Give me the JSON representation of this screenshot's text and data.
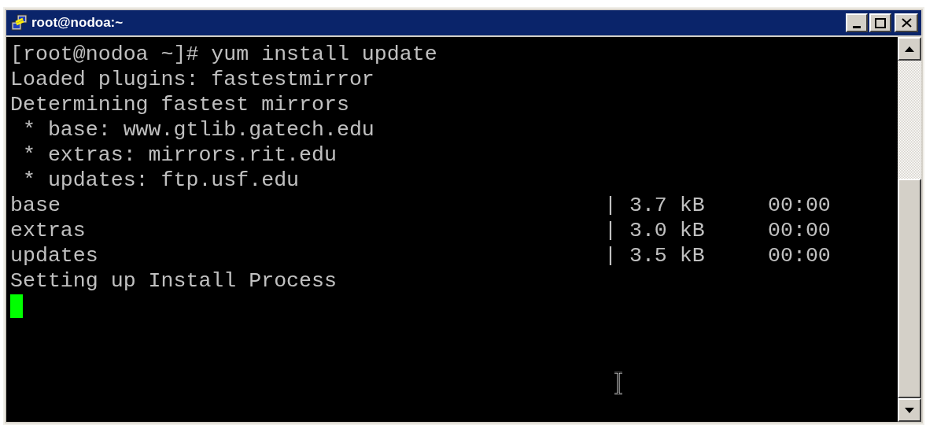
{
  "window": {
    "title": "root@nodoa:~"
  },
  "terminal": {
    "lines": [
      {
        "kind": "text",
        "text": "[root@nodoa ~]# yum install update"
      },
      {
        "kind": "text",
        "text": "Loaded plugins: fastestmirror"
      },
      {
        "kind": "text",
        "text": "Determining fastest mirrors"
      },
      {
        "kind": "text",
        "text": " * base: www.gtlib.gatech.edu"
      },
      {
        "kind": "text",
        "text": " * extras: mirrors.rit.edu"
      },
      {
        "kind": "text",
        "text": " * updates: ftp.usf.edu"
      },
      {
        "kind": "row",
        "name": "base",
        "size": "| 3.7 kB",
        "time": "00:00"
      },
      {
        "kind": "row",
        "name": "extras",
        "size": "| 3.0 kB",
        "time": "00:00"
      },
      {
        "kind": "row",
        "name": "updates",
        "size": "| 3.5 kB",
        "time": "00:00"
      },
      {
        "kind": "text",
        "text": "Setting up Install Process"
      },
      {
        "kind": "cursor"
      }
    ]
  }
}
